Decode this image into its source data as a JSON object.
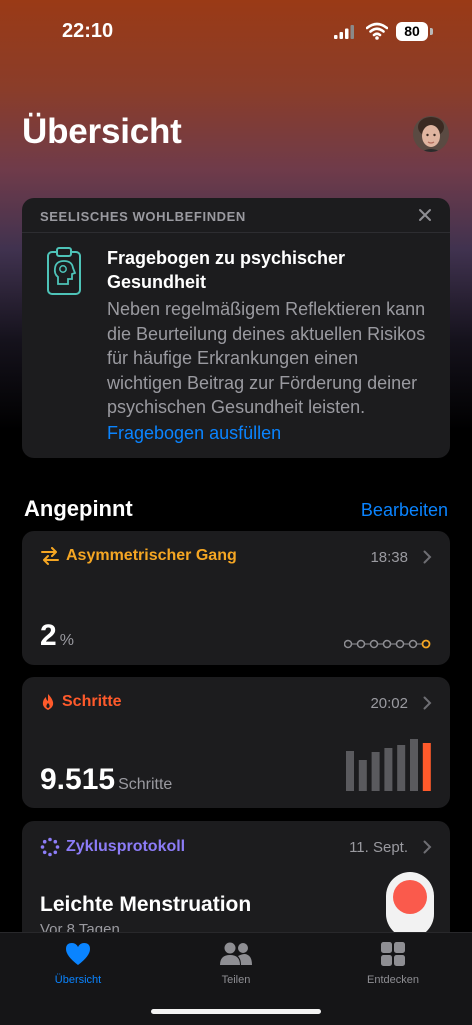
{
  "status_bar": {
    "time": "22:10",
    "battery": "80"
  },
  "header": {
    "title": "Übersicht"
  },
  "mental_wellbeing": {
    "heading": "SEELISCHES WOHLBEFINDEN",
    "title": "Fragebogen zu psychischer Gesundheit",
    "body": "Neben regelmäßigem Reflektieren kann die Beurteilung deines aktuellen Risikos für häufige Erkrankungen einen wichtigen Beitrag zur Förderung deiner psychischen Gesundheit leisten.",
    "link": "Fragebogen ausfüllen"
  },
  "pinned": {
    "title": "Angepinnt",
    "edit": "Bearbeiten",
    "cards": [
      {
        "title": "Asymmetrischer Gang",
        "time": "18:38",
        "value": "2",
        "unit": "%",
        "color": "#f5a623",
        "icon": "arrows-icon"
      },
      {
        "title": "Schritte",
        "time": "20:02",
        "value": "9.515",
        "unit": "Schritte",
        "color": "#ff5a2b",
        "icon": "flame-icon",
        "bar_levels": [
          0.72,
          0.55,
          0.7,
          0.76,
          0.82,
          0.92,
          0.86
        ]
      },
      {
        "title": "Zyklusprotokoll",
        "time": "11. Sept.",
        "value": "Leichte Menstruation",
        "sub": "Vor 8 Tagen",
        "color": "#8c7cf7",
        "icon": "cycle-icon"
      }
    ]
  },
  "tabbar": {
    "tabs": [
      {
        "label": "Übersicht",
        "active": true
      },
      {
        "label": "Teilen",
        "active": false
      },
      {
        "label": "Entdecken",
        "active": false
      }
    ]
  }
}
